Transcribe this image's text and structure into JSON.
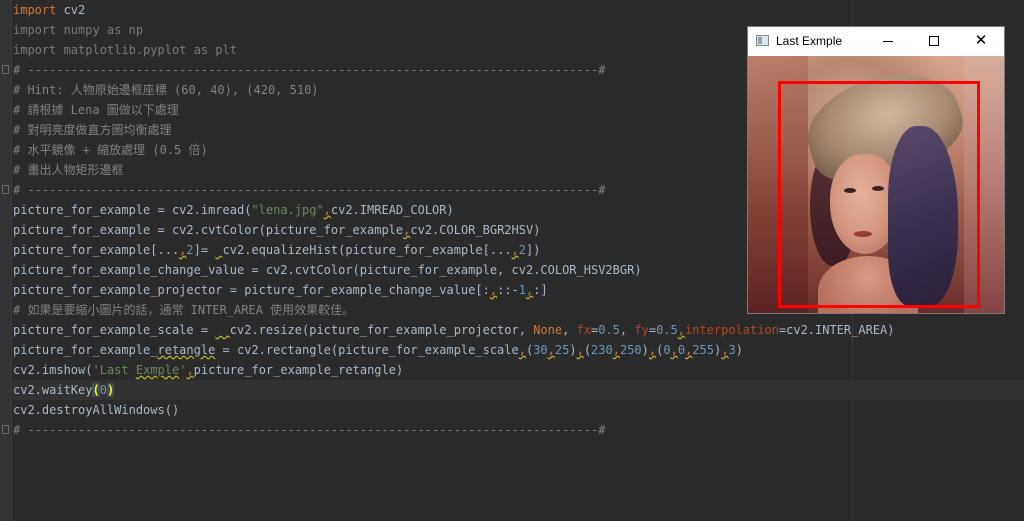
{
  "editor": {
    "lines": [
      [
        {
          "t": "import",
          "c": "kw"
        },
        {
          "t": " cv2"
        }
      ],
      [
        {
          "t": "import numpy as np",
          "c": "gray"
        }
      ],
      [
        {
          "t": "import matplotlib.pyplot as plt",
          "c": "gray"
        }
      ],
      [
        {
          "t": "# -------------------------------------------------------------------------------#",
          "c": "cm"
        }
      ],
      [
        {
          "t": "# Hint: 人物原始邊框座標 (60, 40), (420, 510)",
          "c": "cm"
        }
      ],
      [
        {
          "t": "# 請根據 Lena 圖做以下處理",
          "c": "cm"
        }
      ],
      [
        {
          "t": "# 對明亮度做直方圖均衡處理",
          "c": "cm"
        }
      ],
      [
        {
          "t": "# 水平鏡像 + 縮放處理 (0.5 倍)",
          "c": "cm"
        }
      ],
      [
        {
          "t": "# 畫出人物矩形邊框",
          "c": "cm"
        }
      ],
      [
        {
          "t": "# -------------------------------------------------------------------------------#",
          "c": "cm"
        }
      ],
      [
        {
          "t": "picture_for_example = cv2.imread("
        },
        {
          "t": "\"lena.jpg\"",
          "c": "str"
        },
        {
          "t": ",",
          "c": "kw warn"
        },
        {
          "t": "cv2.IMREAD_COLOR)"
        }
      ],
      [
        {
          "t": "picture_for_example = cv2.cvtColor(picture_for_example"
        },
        {
          "t": ",",
          "c": "kw warn"
        },
        {
          "t": "cv2.COLOR_BGR2HSV)"
        }
      ],
      [
        {
          "t": "picture_for_example[..."
        },
        {
          "t": ",",
          "c": "kw warn"
        },
        {
          "t": "2",
          "c": "num"
        },
        {
          "t": "]= "
        },
        {
          "t": " ",
          "c": "warn"
        },
        {
          "t": "cv2.equalizeHist(picture_for_example[..."
        },
        {
          "t": ",",
          "c": "kw warn"
        },
        {
          "t": "2",
          "c": "num"
        },
        {
          "t": "])"
        }
      ],
      [
        {
          "t": "picture_for_example_change_value = cv2.cvtColor(picture_for_example, cv2.COLOR_HSV2BGR)"
        }
      ],
      [
        {
          "t": "picture_for_example_projector = picture_for_example_change_value[:"
        },
        {
          "t": ",",
          "c": "kw warn"
        },
        {
          "t": "::-"
        },
        {
          "t": "1",
          "c": "num"
        },
        {
          "t": ",",
          "c": "kw warn"
        },
        {
          "t": ":]"
        }
      ],
      [
        {
          "t": "# 如果是要縮小圖片的話，通常 INTER_AREA 使用效果較佳。",
          "c": "cm"
        }
      ],
      [
        {
          "t": "picture_for_example_scale = "
        },
        {
          "t": "  ",
          "c": "warn"
        },
        {
          "t": "cv2.resize(picture_for_example_projector, "
        },
        {
          "t": "None",
          "c": "kw"
        },
        {
          "t": ", "
        },
        {
          "t": "fx",
          "c": "param"
        },
        {
          "t": "="
        },
        {
          "t": "0.5",
          "c": "num"
        },
        {
          "t": ", "
        },
        {
          "t": "fy",
          "c": "param"
        },
        {
          "t": "="
        },
        {
          "t": "0.5",
          "c": "num"
        },
        {
          "t": ",",
          "c": "kw warn"
        },
        {
          "t": "interpolation",
          "c": "param"
        },
        {
          "t": "=cv2.INTER_AREA)"
        }
      ],
      [
        {
          "t": "picture_for_example_"
        },
        {
          "t": "retangle",
          "c": "warn"
        },
        {
          "t": " = cv2.rectangle(picture_for_example_scale"
        },
        {
          "t": ",",
          "c": "kw warn"
        },
        {
          "t": "("
        },
        {
          "t": "30",
          "c": "num"
        },
        {
          "t": ",",
          "c": "kw warn"
        },
        {
          "t": "25",
          "c": "num"
        },
        {
          "t": ")"
        },
        {
          "t": ",",
          "c": "kw warn"
        },
        {
          "t": "("
        },
        {
          "t": "230",
          "c": "num"
        },
        {
          "t": ",",
          "c": "kw warn"
        },
        {
          "t": "250",
          "c": "num"
        },
        {
          "t": ")"
        },
        {
          "t": ",",
          "c": "kw warn"
        },
        {
          "t": "("
        },
        {
          "t": "0",
          "c": "num"
        },
        {
          "t": ",",
          "c": "kw warn"
        },
        {
          "t": "0",
          "c": "num"
        },
        {
          "t": ",",
          "c": "kw warn"
        },
        {
          "t": "255",
          "c": "num"
        },
        {
          "t": ")"
        },
        {
          "t": ",",
          "c": "kw warn"
        },
        {
          "t": "3",
          "c": "num"
        },
        {
          "t": ")"
        }
      ],
      [
        {
          "t": "cv2.imshow("
        },
        {
          "t": "'Last ",
          "c": "str"
        },
        {
          "t": "Exmple",
          "c": "str warn"
        },
        {
          "t": "'",
          "c": "str"
        },
        {
          "t": ",",
          "c": "kw warn"
        },
        {
          "t": "picture_for_example_retangle)"
        }
      ],
      [
        {
          "t": "cv2.waitKey"
        },
        {
          "t": "(",
          "c": "bracket"
        },
        {
          "t": "0",
          "c": "num"
        },
        {
          "t": ")",
          "c": "bracket"
        }
      ],
      [
        {
          "t": "cv2.destroyAllWindows()"
        }
      ],
      [
        {
          "t": "# -------------------------------------------------------------------------------#",
          "c": "cm"
        }
      ]
    ],
    "current_line": 19
  },
  "window": {
    "title": "Last Exmple",
    "minimize": "─",
    "maximize": "☐",
    "close": "✕"
  }
}
